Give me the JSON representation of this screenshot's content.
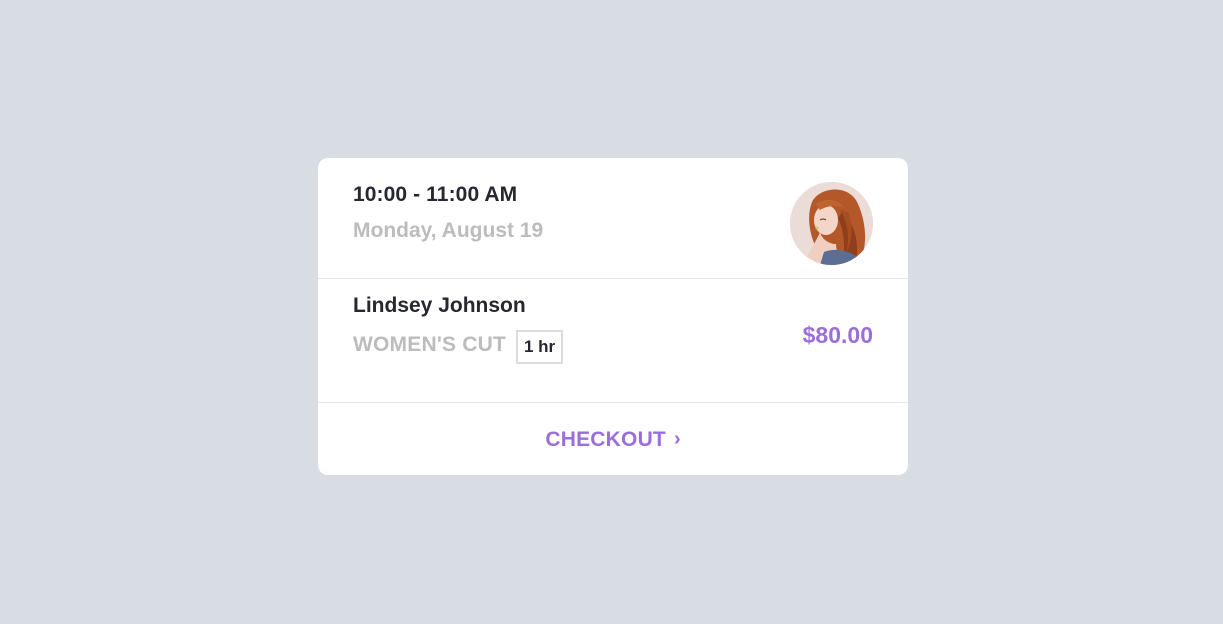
{
  "appointment": {
    "time": "10:00 - 11:00 AM",
    "date": "Monday, August 19"
  },
  "client": {
    "name": "Lindsey Johnson",
    "avatar_icon": "portrait-avatar"
  },
  "service": {
    "name": "WOMEN'S CUT",
    "duration": "1 hr",
    "price": "$80.00"
  },
  "actions": {
    "checkout_label": "CHECKOUT",
    "checkout_icon": "chevron-right-icon"
  },
  "colors": {
    "background": "#d8dde4",
    "accent": "#9a6fd8",
    "primary_text": "#262730",
    "muted_text": "#bcbcbc"
  }
}
